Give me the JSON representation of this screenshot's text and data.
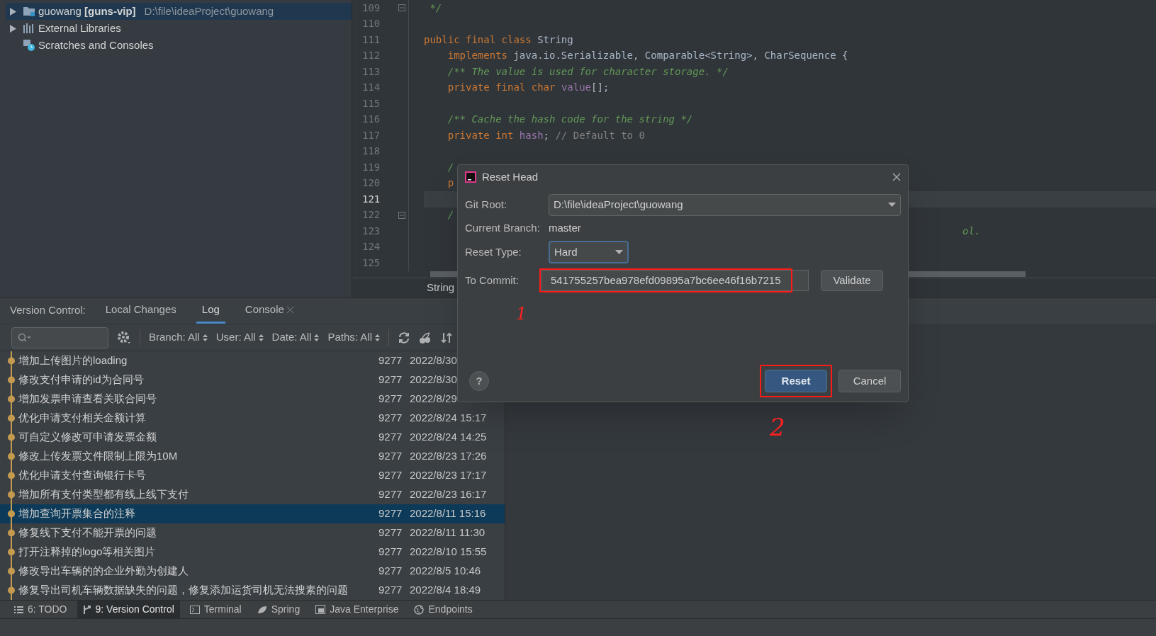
{
  "project_tree": {
    "items": [
      {
        "kind": "module",
        "name": "guowang **[guns-vip]**",
        "path": "D:\\file\\ideaProject\\guowang",
        "expandable": true,
        "selected": true
      },
      {
        "kind": "libraries",
        "name": "External Libraries",
        "expandable": true,
        "selected": false
      },
      {
        "kind": "scratches",
        "name": "Scratches and Consoles",
        "expandable": false,
        "selected": false
      }
    ]
  },
  "editor": {
    "lines": [
      {
        "number": "109",
        "current": false,
        "fold": true,
        "tokens": [
          {
            "kind": "comment",
            "text": " */"
          }
        ]
      },
      {
        "number": "110",
        "current": false,
        "fold": false
      },
      {
        "number": "111",
        "current": false,
        "fold": false,
        "tokens": [
          {
            "kind": "keyword",
            "text": "public final class "
          },
          {
            "kind": "plain",
            "text": "String"
          }
        ]
      },
      {
        "number": "112",
        "current": false,
        "fold": false,
        "tokens": [
          {
            "kind": "keyword",
            "text": "    implements "
          },
          {
            "kind": "plain",
            "text": "java.io.Serializable, Comparable<String>, CharSequence {"
          }
        ]
      },
      {
        "number": "113",
        "current": false,
        "fold": false,
        "tokens": [
          {
            "kind": "comment",
            "text": "    /** The value is used for character storage. */"
          }
        ]
      },
      {
        "number": "114",
        "current": false,
        "fold": false,
        "tokens": [
          {
            "kind": "keyword",
            "text": "    private final char "
          },
          {
            "kind": "field",
            "text": "value"
          },
          {
            "kind": "plain",
            "text": "[];"
          }
        ]
      },
      {
        "number": "115",
        "current": false,
        "fold": false
      },
      {
        "number": "116",
        "current": false,
        "fold": false,
        "tokens": [
          {
            "kind": "comment",
            "text": "    /** Cache the hash code for the string */"
          }
        ]
      },
      {
        "number": "117",
        "current": false,
        "fold": false,
        "tokens": [
          {
            "kind": "keyword",
            "text": "    private int "
          },
          {
            "kind": "field",
            "text": "hash"
          },
          {
            "kind": "plain",
            "text": "; "
          },
          {
            "kind": "line_comment",
            "text": "// Default to 0"
          }
        ]
      },
      {
        "number": "118",
        "current": false,
        "fold": false
      },
      {
        "number": "119",
        "current": false,
        "fold": false,
        "tokens": [
          {
            "kind": "comment",
            "text": "    /"
          }
        ]
      },
      {
        "number": "120",
        "current": false,
        "fold": false,
        "tokens": [
          {
            "kind": "keyword",
            "text": "    p"
          }
        ]
      },
      {
        "number": "121",
        "current": true,
        "fold": false
      },
      {
        "number": "122",
        "current": false,
        "fold": true,
        "tokens": [
          {
            "kind": "comment",
            "text": "    /"
          }
        ]
      },
      {
        "number": "123",
        "current": false,
        "fold": false,
        "tail": "ol."
      },
      {
        "number": "124",
        "current": false,
        "fold": false
      },
      {
        "number": "125",
        "current": false,
        "fold": false
      }
    ],
    "breadcrumb": "String"
  },
  "tool_window": {
    "title": "Version Control:",
    "tabs": [
      {
        "label": "Local Changes",
        "selected": false,
        "closable": false
      },
      {
        "label": "Log",
        "selected": true,
        "closable": false
      },
      {
        "label": "Console",
        "selected": false,
        "closable": true
      }
    ],
    "filters": [
      "Branch: All",
      "User: All",
      "Date: All",
      "Paths: All"
    ],
    "log": [
      {
        "message": "增加上传图片的loading",
        "author": "9277",
        "date": "2022/8/30",
        "selected": false
      },
      {
        "message": "修改支付申请的id为合同号",
        "author": "9277",
        "date": "2022/8/30",
        "selected": false
      },
      {
        "message": "增加发票申请查看关联合同号",
        "author": "9277",
        "date": "2022/8/29",
        "selected": false
      },
      {
        "message": "优化申请支付相关金额计算",
        "author": "9277",
        "date": "2022/8/24 15:17",
        "selected": false
      },
      {
        "message": "可自定义修改可申请发票金额",
        "author": "9277",
        "date": "2022/8/24 14:25",
        "selected": false
      },
      {
        "message": "修改上传发票文件限制上限为10M",
        "author": "9277",
        "date": "2022/8/23 17:26",
        "selected": false
      },
      {
        "message": "优化申请支付查询银行卡号",
        "author": "9277",
        "date": "2022/8/23 17:17",
        "selected": false
      },
      {
        "message": "增加所有支付类型都有线上线下支付",
        "author": "9277",
        "date": "2022/8/23 16:17",
        "selected": false
      },
      {
        "message": "增加查询开票集合的注释",
        "author": "9277",
        "date": "2022/8/11 15:16",
        "selected": true
      },
      {
        "message": "修复线下支付不能开票的问题",
        "author": "9277",
        "date": "2022/8/11 11:30",
        "selected": false
      },
      {
        "message": "打开注释掉的logo等相关图片",
        "author": "9277",
        "date": "2022/8/10 15:55",
        "selected": false
      },
      {
        "message": "修改导出车辆的的企业外勤为创建人",
        "author": "9277",
        "date": "2022/8/5 10:46",
        "selected": false
      },
      {
        "message": "修复导出司机车辆数据缺失的问题，修复添加运货司机无法搜素的问题",
        "author": "9277",
        "date": "2022/8/4 18:49",
        "selected": false
      }
    ]
  },
  "bottom_bar": [
    {
      "kind": "todo",
      "label": "6: TODO",
      "selected": false
    },
    {
      "kind": "vcs",
      "label": "9: Version Control",
      "selected": true
    },
    {
      "kind": "terminal",
      "label": "Terminal",
      "selected": false
    },
    {
      "kind": "spring",
      "label": "Spring",
      "selected": false
    },
    {
      "kind": "enterprise",
      "label": "Java Enterprise",
      "selected": false
    },
    {
      "kind": "endpoints",
      "label": "Endpoints",
      "selected": false
    }
  ],
  "dialog": {
    "title": "Reset Head",
    "git_root": {
      "label": "Git Root:",
      "value": "D:\\file\\ideaProject\\guowang"
    },
    "current_branch": {
      "label": "Current Branch:",
      "value": "master"
    },
    "reset_type": {
      "label": "Reset Type:",
      "value": "Hard"
    },
    "to_commit": {
      "label": "To Commit:",
      "value": "541755257bea978efd09895a7bc6ee46f16b7215"
    },
    "validate": "Validate",
    "help": "?",
    "reset": "Reset",
    "cancel": "Cancel"
  },
  "annotations": [
    "1",
    "2"
  ]
}
